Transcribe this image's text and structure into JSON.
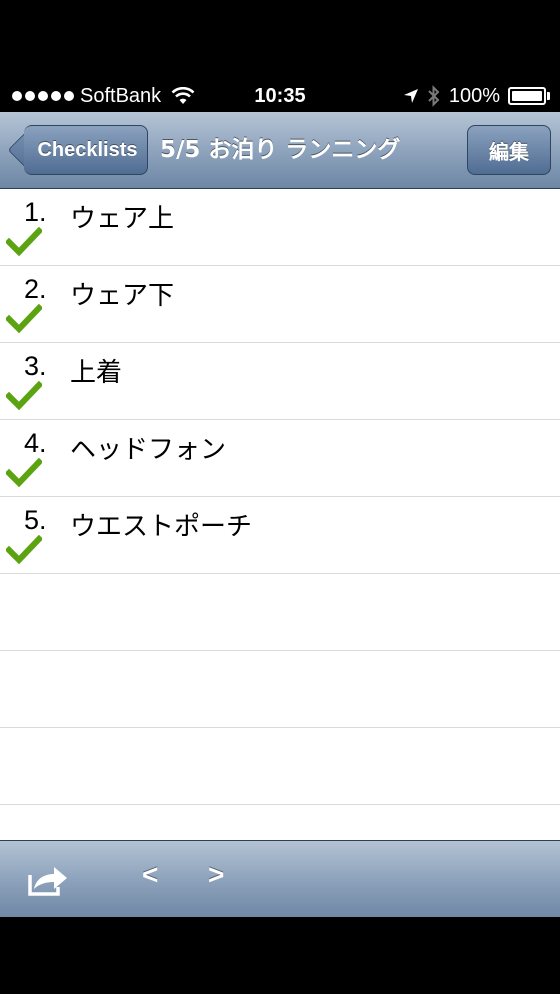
{
  "status_bar": {
    "carrier": "SoftBank",
    "time": "10:35",
    "battery": "100%",
    "battery_level": 1.0,
    "icons": [
      "signal-dots-icon",
      "wifi-icon",
      "location-arrow-icon",
      "bluetooth-icon",
      "battery-icon"
    ]
  },
  "nav": {
    "back_label": "Checklists",
    "title": "5/5  お泊り  ランニング",
    "edit_label": "編集"
  },
  "items": [
    {
      "number": "1.",
      "label": "ウェア上",
      "checked": true
    },
    {
      "number": "2.",
      "label": "ウェア下",
      "checked": true
    },
    {
      "number": "3.",
      "label": "上着",
      "checked": true
    },
    {
      "number": "4.",
      "label": "ヘッドフォン",
      "checked": true
    },
    {
      "number": "5.",
      "label": "ウエストポーチ",
      "checked": true
    }
  ],
  "toolbar": {
    "prev_label": "<",
    "next_label": ">",
    "icons": [
      "share-icon"
    ]
  },
  "colors": {
    "check": "#5ca312",
    "nav_bar": "#8fa4bd"
  }
}
